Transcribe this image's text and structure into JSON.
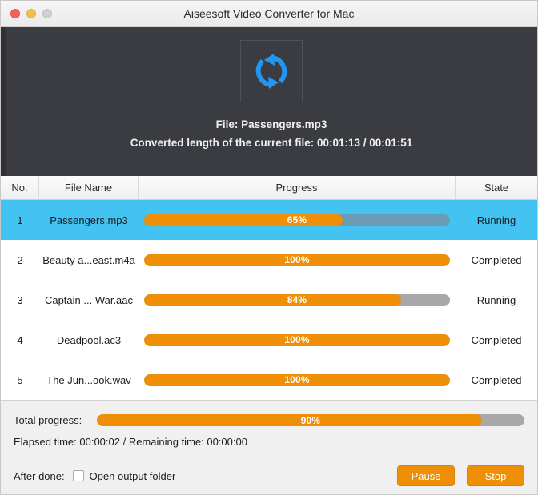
{
  "window": {
    "title": "Aiseesoft Video Converter for Mac",
    "traffic_lights": [
      "close-button",
      "minimize-button",
      "zoom-button"
    ]
  },
  "hero": {
    "icon": "convert-refresh-icon",
    "file_line": "File: Passengers.mp3",
    "length_line": "Converted length of the current file: 00:01:13 / 00:01:51"
  },
  "table": {
    "columns": [
      "No.",
      "File Name",
      "Progress",
      "State"
    ],
    "rows": [
      {
        "no": "1",
        "name": "Passengers.mp3",
        "percent": 65,
        "percent_label": "65%",
        "state": "Running",
        "selected": true
      },
      {
        "no": "2",
        "name": "Beauty a...east.m4a",
        "percent": 100,
        "percent_label": "100%",
        "state": "Completed",
        "selected": false
      },
      {
        "no": "3",
        "name": "Captain ... War.aac",
        "percent": 84,
        "percent_label": "84%",
        "state": "Running",
        "selected": false
      },
      {
        "no": "4",
        "name": "Deadpool.ac3",
        "percent": 100,
        "percent_label": "100%",
        "state": "Completed",
        "selected": false
      },
      {
        "no": "5",
        "name": "The Jun...ook.wav",
        "percent": 100,
        "percent_label": "100%",
        "state": "Completed",
        "selected": false
      }
    ]
  },
  "total": {
    "label": "Total progress:",
    "percent": 90,
    "percent_label": "90%",
    "times": "Elapsed time: 00:00:02 / Remaining time: 00:00:00"
  },
  "footer": {
    "after_done_label": "After done:",
    "checkbox_label": "Open output folder",
    "checkbox_checked": false,
    "pause_label": "Pause",
    "stop_label": "Stop"
  },
  "colors": {
    "accent_orange": "#ef8f08",
    "selection_blue": "#42c3f2",
    "hero_dark": "#3a3c41",
    "track_gray": "#a8a8a8"
  }
}
